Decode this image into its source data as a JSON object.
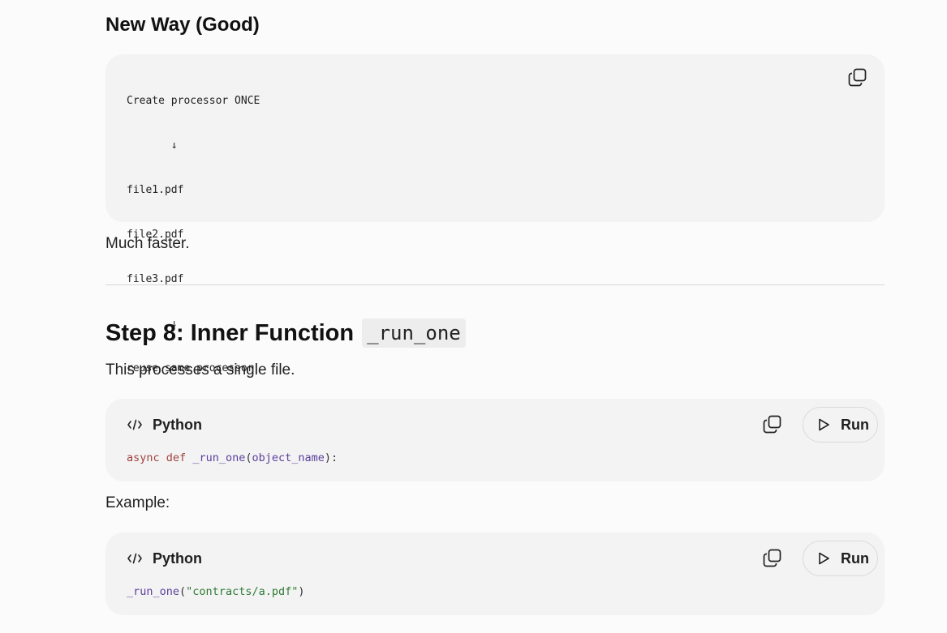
{
  "section_new_way": {
    "heading": "New Way (Good)",
    "code_lines": [
      "Create processor ONCE",
      "       ↓",
      "file1.pdf",
      "file2.pdf",
      "file3.pdf",
      "       ↓",
      "reuse same processor"
    ],
    "after_text": "Much faster."
  },
  "step8": {
    "heading_text": "Step 8: Inner Function",
    "heading_code": "_run_one",
    "intro": "This processes a single file.",
    "block1": {
      "language": "Python",
      "run_label": "Run",
      "tokens": {
        "kw1": "async",
        "kw2": "def",
        "fn": "_run_one",
        "open": "(",
        "arg": "object_name",
        "close": "):"
      }
    },
    "example_label": "Example:",
    "block2": {
      "language": "Python",
      "run_label": "Run",
      "tokens": {
        "fn": "_run_one",
        "open": "(",
        "str": "\"contracts/a.pdf\"",
        "close": ")"
      }
    }
  },
  "icons": {
    "copy": "copy-icon",
    "code": "code-icon",
    "play": "play-icon"
  },
  "colors": {
    "keyword": "#a0433f",
    "function": "#5b3f9c",
    "string": "#2f7a35",
    "code_bg": "#f3f3f3",
    "page_bg": "#fbfbfb"
  }
}
